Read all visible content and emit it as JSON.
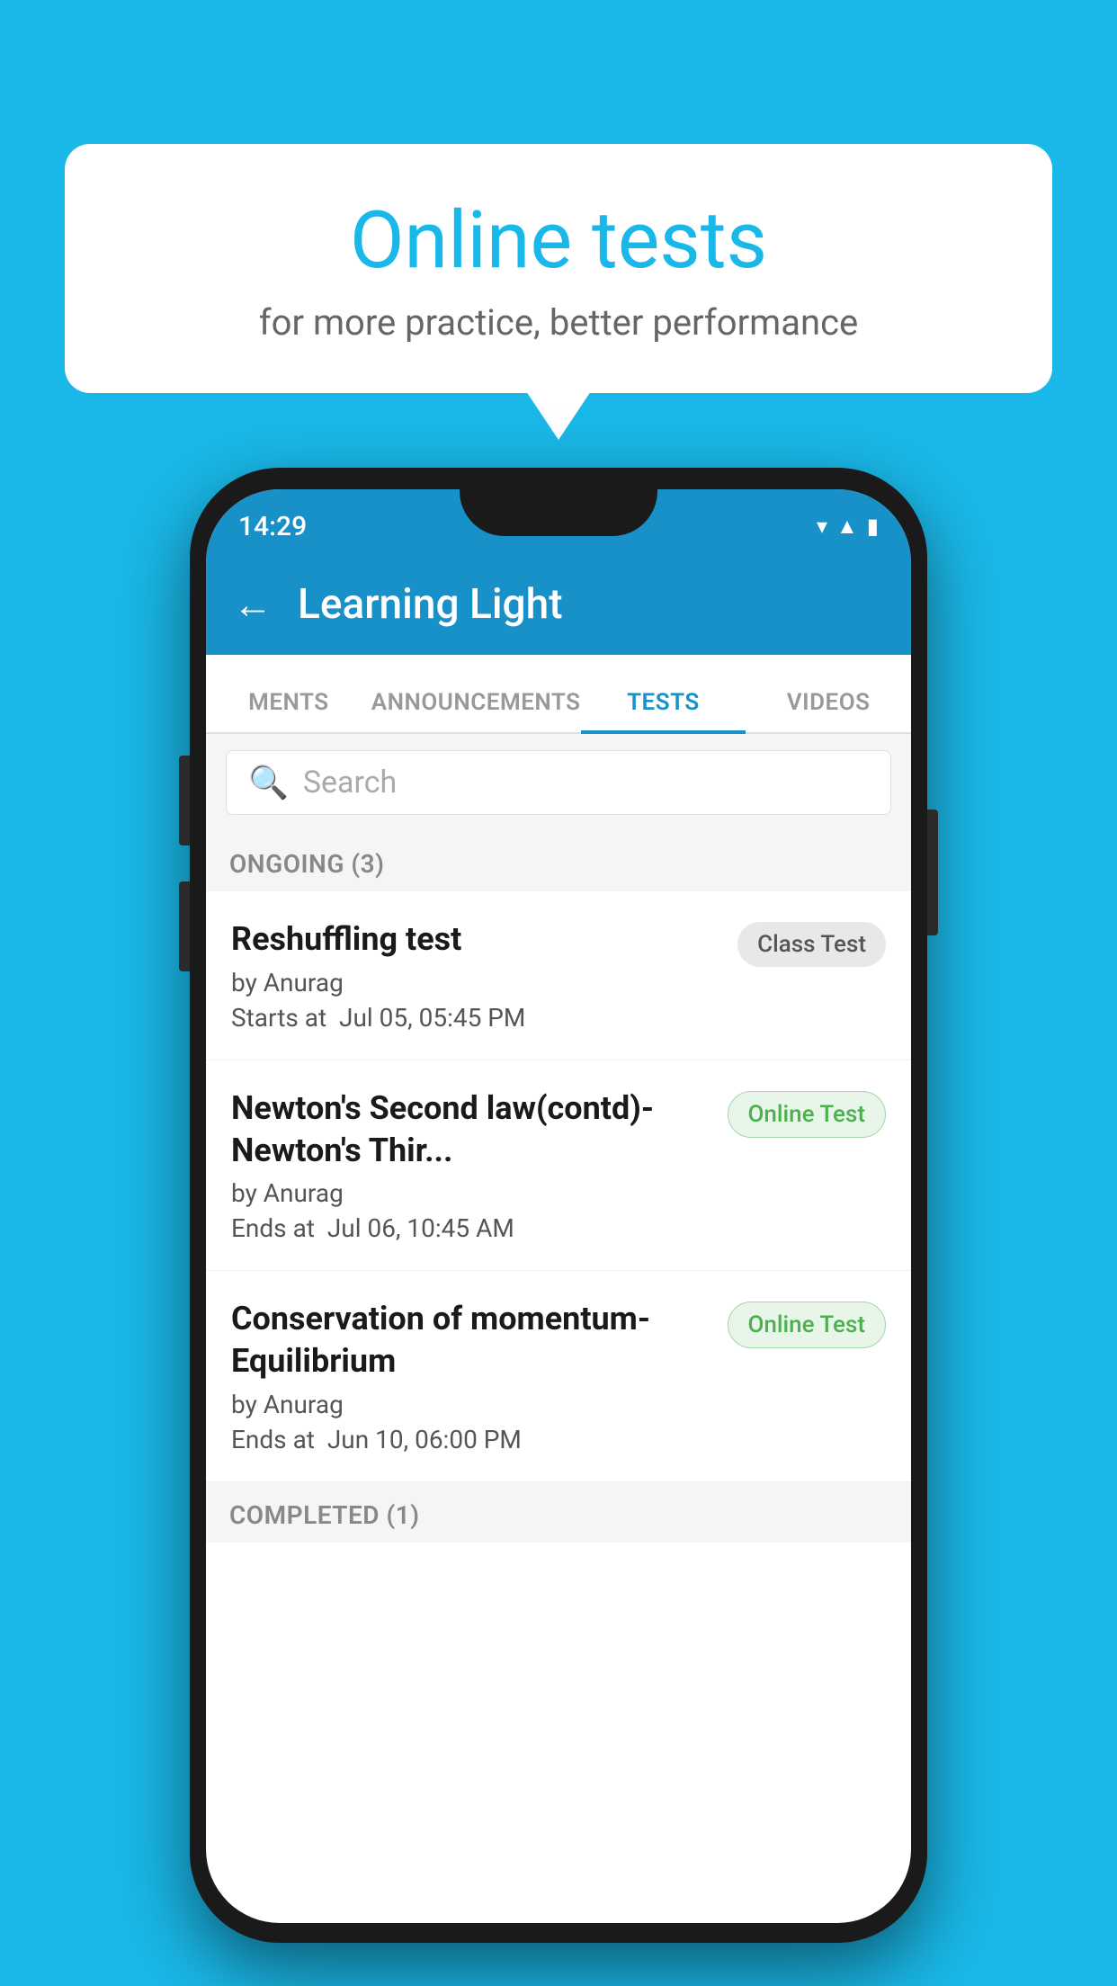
{
  "background": {
    "color": "#1ab8e8"
  },
  "speech_bubble": {
    "title": "Online tests",
    "subtitle": "for more practice, better performance"
  },
  "phone": {
    "status_bar": {
      "time": "14:29",
      "icons": [
        "wifi",
        "signal",
        "battery"
      ]
    },
    "app_bar": {
      "back_icon": "←",
      "title": "Learning Light"
    },
    "tabs": [
      {
        "label": "MENTS",
        "active": false
      },
      {
        "label": "ANNOUNCEMENTS",
        "active": false
      },
      {
        "label": "TESTS",
        "active": true
      },
      {
        "label": "VIDEOS",
        "active": false
      }
    ],
    "search": {
      "placeholder": "Search",
      "icon": "🔍"
    },
    "sections": [
      {
        "header": "ONGOING (3)",
        "items": [
          {
            "name": "Reshuffling test",
            "author": "by Anurag",
            "time_label": "Starts at",
            "time": "Jul 05, 05:45 PM",
            "badge": "Class Test",
            "badge_type": "class"
          },
          {
            "name": "Newton's Second law(contd)-Newton's Thir...",
            "author": "by Anurag",
            "time_label": "Ends at",
            "time": "Jul 06, 10:45 AM",
            "badge": "Online Test",
            "badge_type": "online"
          },
          {
            "name": "Conservation of momentum-Equilibrium",
            "author": "by Anurag",
            "time_label": "Ends at",
            "time": "Jun 10, 06:00 PM",
            "badge": "Online Test",
            "badge_type": "online"
          }
        ]
      }
    ],
    "completed_section": "COMPLETED (1)"
  }
}
